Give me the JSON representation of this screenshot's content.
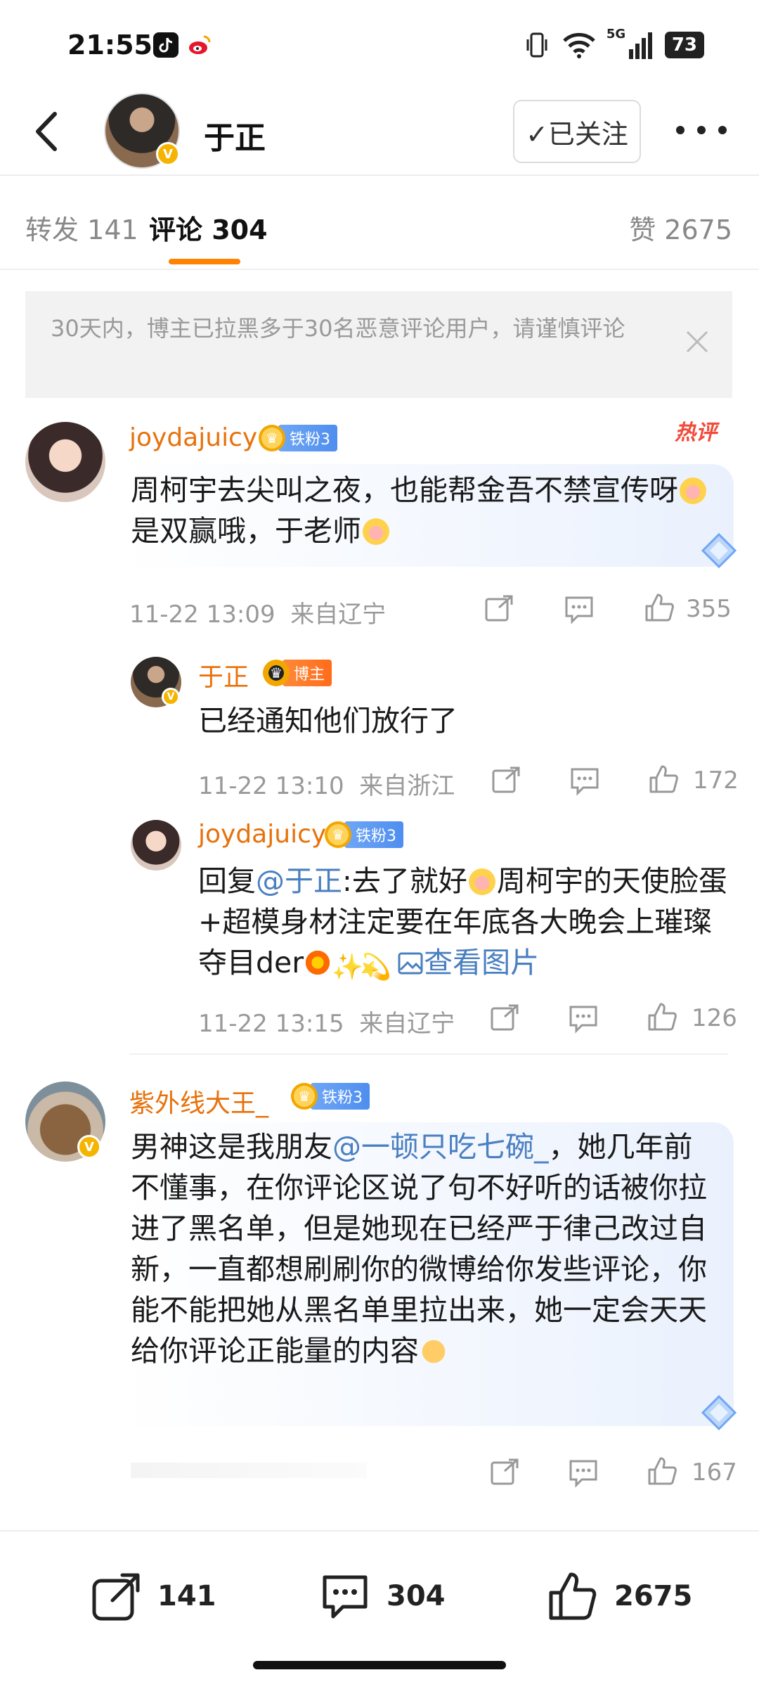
{
  "status_bar": {
    "time": "21:55",
    "network": "5G",
    "battery": "73",
    "icons": [
      "tiktok-icon",
      "weibo-icon",
      "vibrate-icon",
      "wifi-icon",
      "signal-icon"
    ]
  },
  "header": {
    "title": "于正",
    "follow_label": "✓已关注"
  },
  "tabs": [
    {
      "label": "转发 141"
    },
    {
      "label": "评论 304"
    },
    {
      "label": "赞 2675"
    }
  ],
  "notice": {
    "text": "30天内，博主已拉黑多于30名恶意评论用户，请谨慎评论"
  },
  "comments": [
    {
      "user": "joydajuicy",
      "badge": "铁粉3",
      "hot_tag": "热评",
      "text_a": "周柯宇去尖叫之夜，也能帮金吾不禁宣传呀",
      "text_b": "是双赢哦，于老师",
      "time": "11-22 13:09",
      "location": "来自辽宁",
      "likes": "355",
      "replies": [
        {
          "user": "于正",
          "badge": "博主",
          "text": "已经通知他们放行了",
          "time": "11-22 13:10",
          "location": "来自浙江",
          "likes": "172"
        },
        {
          "user": "joydajuicy",
          "badge": "铁粉3",
          "reply_prefix": "回复",
          "mention": "@于正",
          "text_a": ":去了就好",
          "text_b": "周柯宇的天使脸蛋+超模身材注定要在年底各大晚会上璀璨夺目der",
          "image_link": "查看图片",
          "time": "11-22 13:15",
          "location": "来自辽宁",
          "likes": "126"
        }
      ]
    },
    {
      "user": "紫外线大王_",
      "badge": "铁粉3",
      "text_a": "男神这是我朋友",
      "mention": "@一顿只吃七碗_",
      "text_b": "，她几年前不懂事，在你评论区说了句不好听的话被你拉进了黑名单，但是她现在已经严于律己改过自新，一直都想刷刷你的微博给你发些评论，你能不能把她从黑名单里拉出来，她一定会天天给你评论正能量的内容",
      "likes": "167"
    }
  ],
  "bottom_bar": {
    "reposts": "141",
    "comments": "304",
    "likes": "2675"
  }
}
